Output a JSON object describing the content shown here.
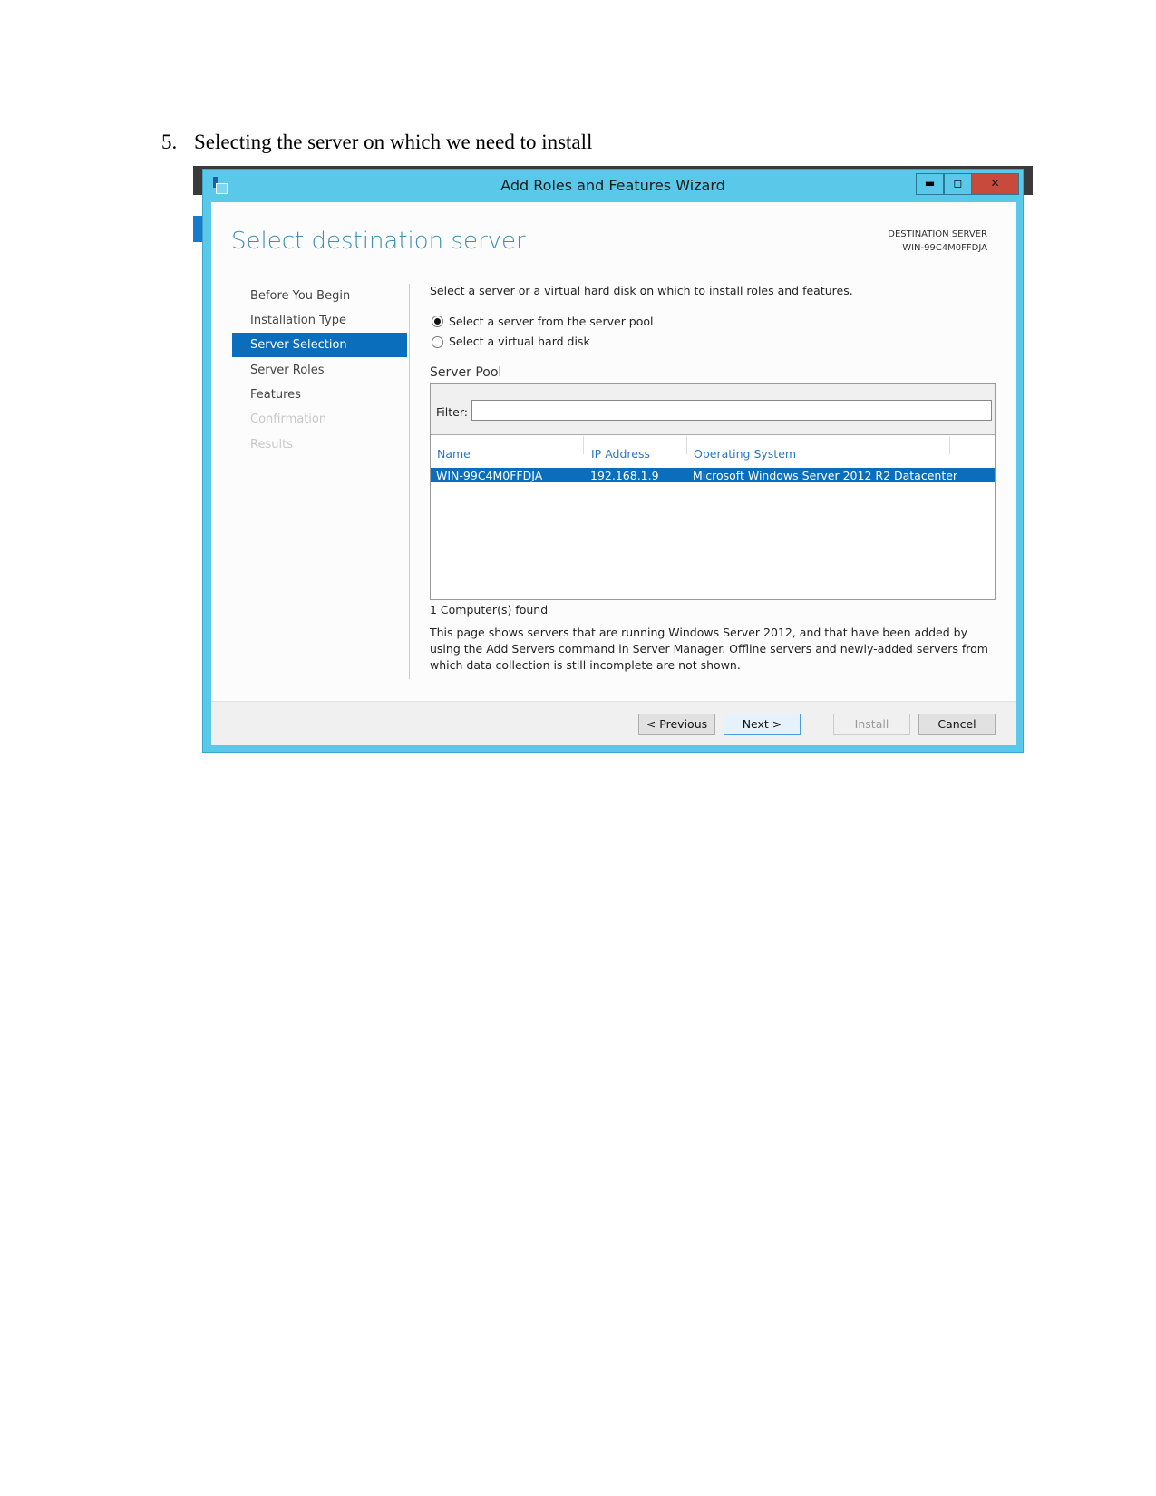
{
  "caption": {
    "number": "5.",
    "text": "Selecting the server on which we need to install"
  },
  "window": {
    "title": "Add Roles and Features Wizard",
    "minimize": "▬",
    "maximize": "◻",
    "close": "✕"
  },
  "page": {
    "heading": "Select destination server",
    "dest_label": "DESTINATION SERVER",
    "dest_value": "WIN-99C4M0FFDJA"
  },
  "nav": [
    {
      "label": "Before You Begin"
    },
    {
      "label": "Installation Type"
    },
    {
      "label": "Server Selection"
    },
    {
      "label": "Server Roles"
    },
    {
      "label": "Features"
    },
    {
      "label": "Confirmation"
    },
    {
      "label": "Results"
    }
  ],
  "intro": "Select a server or a virtual hard disk on which to install roles and features.",
  "options": [
    "Select a server from the server pool",
    "Select a virtual hard disk"
  ],
  "pool": {
    "title": "Server Pool",
    "filter_label": "Filter:",
    "filter_value": "",
    "columns": [
      "Name",
      "IP Address",
      "Operating System"
    ],
    "rows": [
      [
        "WIN-99C4M0FFDJA",
        "192.168.1.9",
        "Microsoft Windows Server 2012 R2 Datacenter"
      ]
    ]
  },
  "found": "1 Computer(s) found",
  "note": "This page shows servers that are running Windows Server 2012, and that have been added by using the Add Servers command in Server Manager. Offline servers and newly-added servers from which data collection is still incomplete are not shown.",
  "buttons": {
    "previous": "< Previous",
    "next": "Next >",
    "install": "Install",
    "cancel": "Cancel"
  }
}
